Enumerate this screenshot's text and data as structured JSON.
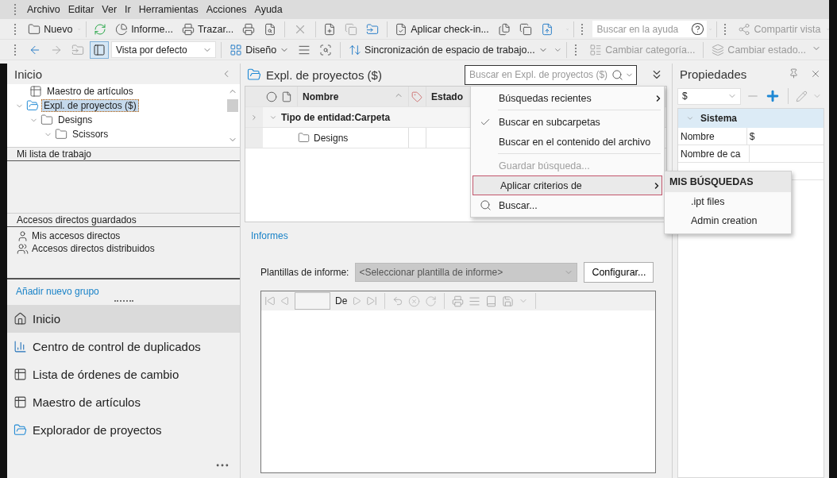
{
  "menu_bar": [
    "Archivo",
    "Editar",
    "Ver",
    "Ir",
    "Herramientas",
    "Acciones",
    "Ayuda"
  ],
  "toolbar_1": {
    "new": "Nuevo",
    "report": "Informe...",
    "plot": "Trazar...",
    "check_in": "Aplicar check-in...",
    "help_search": {
      "placeholder": "Buscar en la ayuda"
    },
    "share_view": {
      "label": "Compartir vista",
      "disabled": true
    }
  },
  "toolbar_2": {
    "view_select": "Vista por defecto",
    "layout": "Diseño",
    "sync": "Sincronización de espacio de trabajo...",
    "change_category": {
      "label": "Cambiar categoría...",
      "disabled": true
    },
    "change_state": {
      "label": "Cambiar estado...",
      "disabled": true
    }
  },
  "left_pane": {
    "title": "Inicio",
    "tree": [
      {
        "label": "Maestro de artículos",
        "kind": "table",
        "selected": false
      },
      {
        "label": "Expl. de proyectos ($)",
        "kind": "explorer",
        "selected": true,
        "expanded": true,
        "children": [
          {
            "label": "Designs",
            "kind": "folder",
            "selected": false,
            "expanded": true,
            "children": [
              {
                "label": "Scissors",
                "kind": "folder",
                "selected": false,
                "expanded": true
              }
            ]
          }
        ]
      }
    ],
    "work_list": {
      "title": "Mi lista de trabajo"
    },
    "shortcuts": {
      "title": "Accesos directos guardados",
      "items": [
        {
          "label": "Mis accesos directos",
          "kind": "user"
        },
        {
          "label": "Accesos directos distribuidos",
          "kind": "shared"
        }
      ]
    },
    "add_group": "Añadir nuevo grupo",
    "nav": [
      {
        "label": "Inicio",
        "kind": "home",
        "selected": true
      },
      {
        "label": "Centro de control de duplicados",
        "kind": "chart",
        "selected": false
      },
      {
        "label": "Lista de órdenes de cambio",
        "kind": "table",
        "selected": false
      },
      {
        "label": "Maestro de artículos",
        "kind": "table",
        "selected": false
      },
      {
        "label": "Explorador de proyectos",
        "kind": "explorer",
        "selected": false
      }
    ]
  },
  "center": {
    "title": "Expl. de proyectos ($)",
    "search": {
      "placeholder": "Buscar en Expl. de proyectos ($)"
    },
    "table": {
      "columns": [
        "Nombre",
        "Estado"
      ],
      "group": "Tipo de entidad:Carpeta",
      "rows": [
        {
          "name": "Designs"
        }
      ]
    },
    "search_menu": {
      "items": [
        {
          "kind": "submenu",
          "label": "Búsquedas recientes",
          "selected": false
        },
        {
          "kind": "separator"
        },
        {
          "kind": "check",
          "label": "Buscar en subcarpetas",
          "checked": true
        },
        {
          "kind": "check",
          "label": "Buscar en el contenido del archivo",
          "checked": false
        },
        {
          "kind": "separator"
        },
        {
          "kind": "item",
          "label": "Guardar búsqueda...",
          "disabled": true
        },
        {
          "kind": "submenu",
          "label": "Aplicar criterios de",
          "selected": true
        },
        {
          "kind": "search",
          "label": "Buscar..."
        }
      ],
      "submenu": {
        "heading": "MIS BÚSQUEDAS",
        "items": [
          ".ipt files",
          "Admin creation"
        ]
      }
    },
    "reports": {
      "title": "Informes",
      "template_label": "Plantillas de informe:",
      "template_select": {
        "placeholder": "<Seleccionar plantilla de informe>",
        "disabled": true
      },
      "configure": "Configurar...",
      "viewer": {
        "of_label": "De"
      }
    }
  },
  "properties": {
    "title": "Propiedades",
    "select": "$",
    "section": "Sistema",
    "rows": [
      {
        "name": "Nombre",
        "value": "$"
      },
      {
        "name": "Nombre de ca"
      }
    ]
  }
}
